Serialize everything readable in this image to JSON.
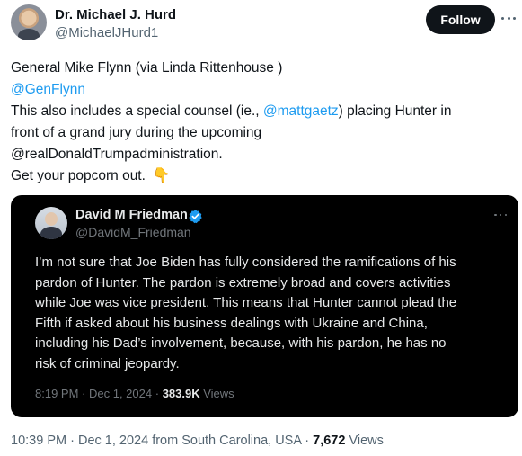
{
  "author": {
    "name": "Dr. Michael J. Hurd",
    "handle": "@MichaelJHurd1",
    "follow_label": "Follow"
  },
  "tweet": {
    "line1": "General Mike Flynn (via Linda Rittenhouse )",
    "line2_mention": "@GenFlynn",
    "line3_pre": "This also includes a special counsel (ie., ",
    "line3_mention": "@mattgaetz",
    "line3_post": ") placing Hunter in",
    "line4": "front of a grand jury during the upcoming",
    "line5": "@realDonaldTrumpadministration.",
    "line6": "Get your popcorn out.",
    "emoji_icon": "finger-pointing-down"
  },
  "quote": {
    "name": "David M Friedman",
    "handle": "@DavidM_Friedman",
    "lines": [
      "I’m not sure that Joe Biden has fully considered the ramifications of his",
      "pardon of Hunter. The pardon is extremely broad and covers activities",
      "while Joe was vice president. This means that Hunter cannot plead the",
      "Fifth if asked about his business dealings with Ukraine and China,",
      "including his Dad’s involvement, because, with his pardon,  he has no",
      "risk of criminal jeopardy."
    ],
    "time": "8:19 PM",
    "date": "Dec 1, 2024",
    "views_count": "383.9K",
    "views_label": "Views"
  },
  "meta": {
    "time": "10:39 PM",
    "date": "Dec 1, 2024",
    "location": "from South Carolina, USA",
    "views_count": "7,672",
    "views_label": "Views"
  },
  "colors": {
    "link": "#1d9bf0",
    "verified": "#1d9bf0",
    "muted": "#536471",
    "card_bg": "#000000"
  }
}
